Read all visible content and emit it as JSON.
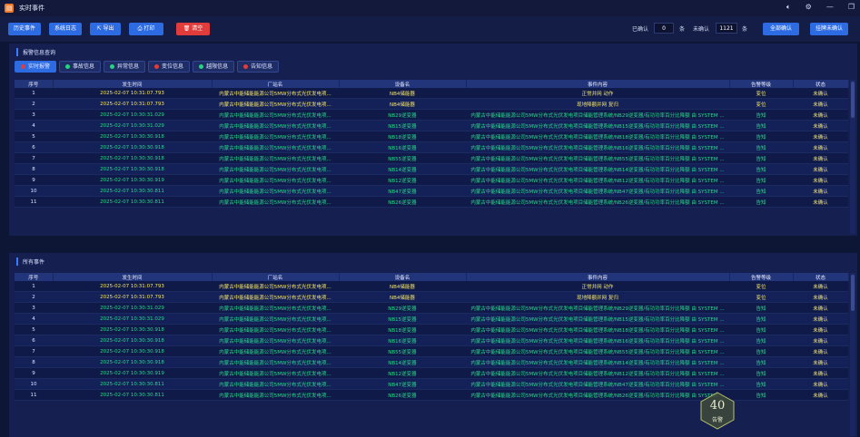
{
  "window": {
    "title": "实时事件",
    "logo": "app-logo-icon",
    "controls": [
      "speaker-icon",
      "settings-icon",
      "minimize-icon",
      "restore-icon"
    ]
  },
  "toolbar": {
    "history_label": "历史事件",
    "syslog_label": "系统日志",
    "export_label": "导出",
    "print_label": "打印",
    "clear_label": "清空",
    "confirmed_label": "已确认",
    "confirmed_count": "0",
    "unit1": "条",
    "unconfirmed_label": "未确认",
    "unconfirmed_count": "1121",
    "unit2": "条",
    "confirm_all_label": "全部确认",
    "abnormal_unconfirmed_label": "挂牌未确认"
  },
  "alarm_panel": {
    "title": "报警信息查询",
    "filters": [
      {
        "label": "实时报警",
        "color": "#e03c3c",
        "active": true
      },
      {
        "label": "事故信息",
        "color": "#22d67a",
        "active": false
      },
      {
        "label": "异常信息",
        "color": "#22d67a",
        "active": false
      },
      {
        "label": "变位信息",
        "color": "#e03c3c",
        "active": false
      },
      {
        "label": "越限信息",
        "color": "#22d67a",
        "active": false
      },
      {
        "label": "告知信息",
        "color": "#e03c3c",
        "active": false
      }
    ]
  },
  "all_panel": {
    "title": "所有事件"
  },
  "columns": [
    "序号",
    "发生时间",
    "厂站名",
    "设备名",
    "事件内容",
    "告警等级",
    "状态"
  ],
  "rows": [
    {
      "idx": "1",
      "time": "2025-02-07 10:31:07.793",
      "station": "内蒙古中能储能能源公司5MW分布式光伏发电项...",
      "device": "NB4储能器",
      "content": "正常并网 动作",
      "level": "变位",
      "status": "未确认",
      "tone": "y"
    },
    {
      "idx": "2",
      "time": "2025-02-07 10:31:07.793",
      "station": "内蒙古中能储能能源公司5MW分布式光伏发电项...",
      "device": "NB4储能器",
      "content": "现地降额并网 复归",
      "level": "变位",
      "status": "未确认",
      "tone": "y"
    },
    {
      "idx": "3",
      "time": "2025-02-07 10:30:31.029",
      "station": "内蒙古中能储能能源公司5MW分布式光伏发电项...",
      "device": "NB29逆变器",
      "content": "内蒙古中能储能能源公司5MW分布式光伏发电项目储能管理系统/NB29逆变器/有功功率百分比降额 由 SYSTEM ...",
      "level": "告知",
      "status": "未确认",
      "tone": "g"
    },
    {
      "idx": "4",
      "time": "2025-02-07 10:30:31.029",
      "station": "内蒙古中能储能能源公司5MW分布式光伏发电项...",
      "device": "NB15逆变器",
      "content": "内蒙古中能储能能源公司5MW分布式光伏发电项目储能管理系统/NB15逆变器/有功功率百分比降额 由 SYSTEM ...",
      "level": "告知",
      "status": "未确认",
      "tone": "g"
    },
    {
      "idx": "5",
      "time": "2025-02-07 10:30:30.918",
      "station": "内蒙古中能储能能源公司5MW分布式光伏发电项...",
      "device": "NB18逆变器",
      "content": "内蒙古中能储能能源公司5MW分布式光伏发电项目储能管理系统/NB18逆变器/有功功率百分比降额 由 SYSTEM ...",
      "level": "告知",
      "status": "未确认",
      "tone": "g"
    },
    {
      "idx": "6",
      "time": "2025-02-07 10:30:30.918",
      "station": "内蒙古中能储能能源公司5MW分布式光伏发电项...",
      "device": "NB16逆变器",
      "content": "内蒙古中能储能能源公司5MW分布式光伏发电项目储能管理系统/NB16逆变器/有功功率百分比降额 由 SYSTEM ...",
      "level": "告知",
      "status": "未确认",
      "tone": "g"
    },
    {
      "idx": "7",
      "time": "2025-02-07 10:30:30.918",
      "station": "内蒙古中能储能能源公司5MW分布式光伏发电项...",
      "device": "NB55逆变器",
      "content": "内蒙古中能储能能源公司5MW分布式光伏发电项目储能管理系统/NB55逆变器/有功功率百分比降额 由 SYSTEM ...",
      "level": "告知",
      "status": "未确认",
      "tone": "g"
    },
    {
      "idx": "8",
      "time": "2025-02-07 10:30:30.918",
      "station": "内蒙古中能储能能源公司5MW分布式光伏发电项...",
      "device": "NB14逆变器",
      "content": "内蒙古中能储能能源公司5MW分布式光伏发电项目储能管理系统/NB14逆变器/有功功率百分比降额 由 SYSTEM ...",
      "level": "告知",
      "status": "未确认",
      "tone": "g"
    },
    {
      "idx": "9",
      "time": "2025-02-07 10:30:30.919",
      "station": "内蒙古中能储能能源公司5MW分布式光伏发电项...",
      "device": "NB12逆变器",
      "content": "内蒙古中能储能能源公司5MW分布式光伏发电项目储能管理系统/NB12逆变器/有功功率百分比降额 由 SYSTEM ...",
      "level": "告知",
      "status": "未确认",
      "tone": "g"
    },
    {
      "idx": "10",
      "time": "2025-02-07 10:30:30.811",
      "station": "内蒙古中能储能能源公司5MW分布式光伏发电项...",
      "device": "NB47逆变器",
      "content": "内蒙古中能储能能源公司5MW分布式光伏发电项目储能管理系统/NB47逆变器/有功功率百分比降额 由 SYSTEM ...",
      "level": "告知",
      "status": "未确认",
      "tone": "g"
    },
    {
      "idx": "11",
      "time": "2025-02-07 10:30:30.811",
      "station": "内蒙古中能储能能源公司5MW分布式光伏发电项...",
      "device": "NB26逆变器",
      "content": "内蒙古中能储能能源公司5MW分布式光伏发电项目储能管理系统/NB26逆变器/有功功率百分比降额 由 SYSTEM ...",
      "level": "告知",
      "status": "未确认",
      "tone": "g"
    }
  ],
  "badge": {
    "value": "40",
    "label": "告警"
  },
  "colors": {
    "accent": "#2d6be3",
    "clear_red": "#e03c3c",
    "yellow_text": "#f2e46a",
    "green_text": "#28d98a"
  }
}
